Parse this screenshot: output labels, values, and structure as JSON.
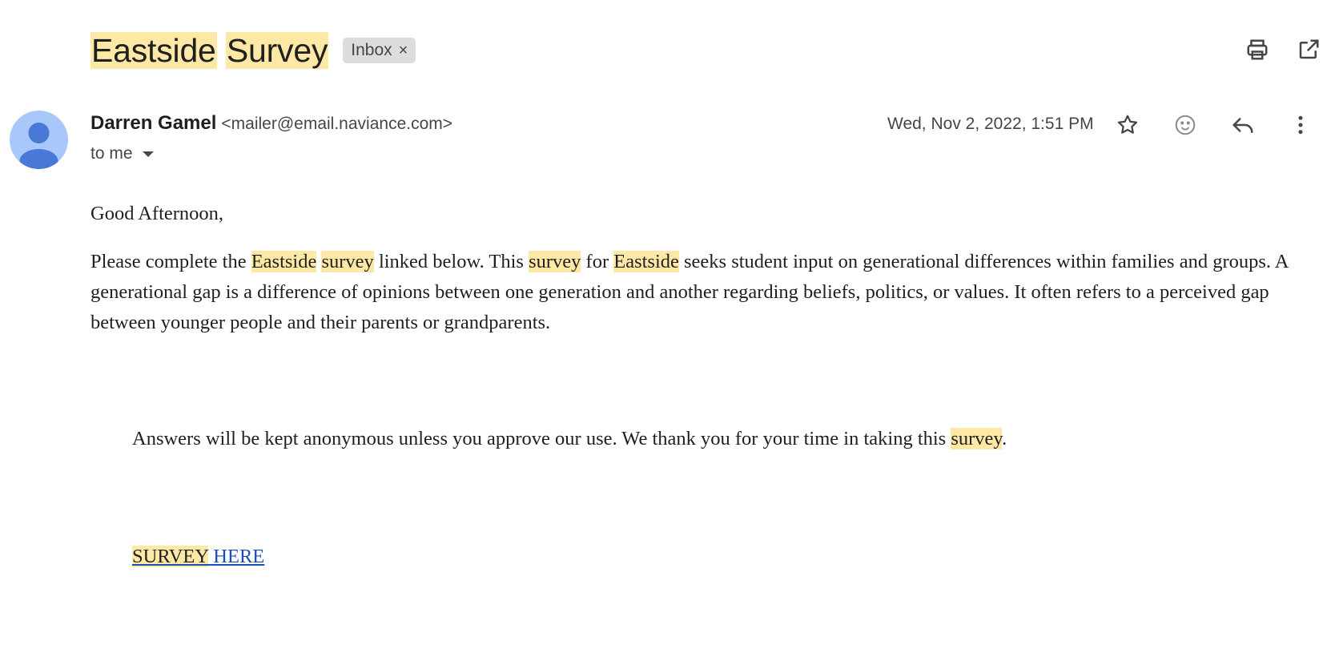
{
  "subject": {
    "word1": "Eastside",
    "word2": "Survey"
  },
  "label_chip": {
    "text": "Inbox",
    "remove": "×"
  },
  "top_icons": [
    "print-icon",
    "open-in-new-window-icon"
  ],
  "sender": {
    "name": "Darren Gamel",
    "email": "<mailer@email.naviance.com>",
    "recipient": "to me"
  },
  "date": "Wed, Nov 2, 2022, 1:51 PM",
  "message_icons": [
    "star-icon",
    "emoji-reaction-icon",
    "reply-icon",
    "more-options-icon"
  ],
  "body": {
    "greeting": "Good Afternoon,",
    "p1": {
      "t1": "Please complete the ",
      "h1": "Eastside",
      "t2": " ",
      "h2": "survey",
      "t3": " linked below. This ",
      "h3": "survey",
      "t4": " for ",
      "h4": "Eastside",
      "t5": " seeks student input on generational differences within families and groups. A generational gap is a difference of opinions between one generation and another regarding beliefs, politics, or values. It often refers to a perceived gap between younger people and their parents or grandparents."
    },
    "p2": {
      "t1": "Answers will be kept anonymous unless you approve our use. We thank you for your time in taking this ",
      "h1": "survey",
      "t2": "."
    },
    "link": {
      "h1": "SURVEY",
      "t1": " HERE"
    }
  },
  "colors": {
    "highlight": "#fde9a5",
    "link": "#1a4fb8",
    "avatar_bg": "#a8c7fa",
    "avatar_fg": "#4a78d6"
  }
}
